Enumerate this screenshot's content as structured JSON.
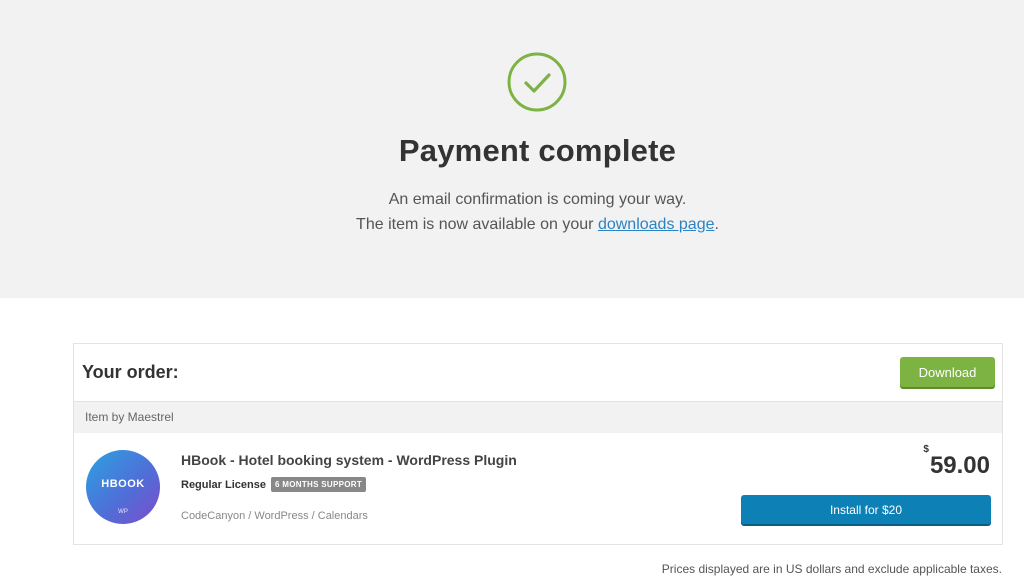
{
  "hero": {
    "title": "Payment complete",
    "line1": "An email confirmation is coming your way.",
    "line2_prefix": "The item is now available on your ",
    "line2_link": "downloads page",
    "line2_suffix": ".",
    "icon": "check-circle-icon",
    "accent_color": "#7cb342"
  },
  "order": {
    "title": "Your order:",
    "download_label": "Download",
    "author": "Item by Maestrel",
    "item": {
      "thumb_text": "HBOOK",
      "thumb_sub": "WP",
      "name": "HBook - Hotel booking system - WordPress Plugin",
      "license": "Regular License",
      "support_badge": "6 MONTHS SUPPORT",
      "breadcrumbs": "CodeCanyon / WordPress / Calendars",
      "currency": "$",
      "price": "59.00",
      "install_label": "Install for $20"
    }
  },
  "footnote": "Prices displayed are in US dollars and exclude applicable taxes.",
  "colors": {
    "download_button": "#7cb342",
    "install_button": "#0d81b5",
    "link": "#2b83c6"
  }
}
